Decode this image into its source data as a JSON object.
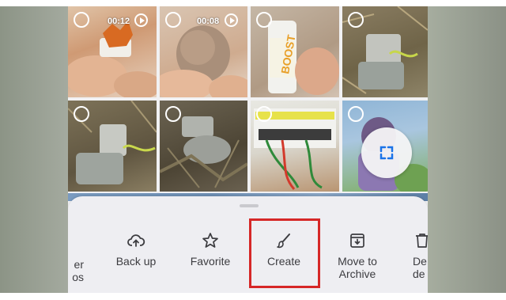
{
  "video_durations": [
    "00:12",
    "00:08"
  ],
  "expand_icon": "expand-corners-icon",
  "actions": {
    "partial_left_line1": "er",
    "partial_left_line2": "os",
    "back_up": "Back up",
    "favorite": "Favorite",
    "create": "Create",
    "move_to_archive_line1": "Move to",
    "move_to_archive_line2": "Archive",
    "partial_right_line1": "De",
    "partial_right_line2": "de"
  },
  "colors": {
    "accent": "#1a73e8",
    "highlight": "#d62727",
    "sheet": "#eeeef2"
  }
}
